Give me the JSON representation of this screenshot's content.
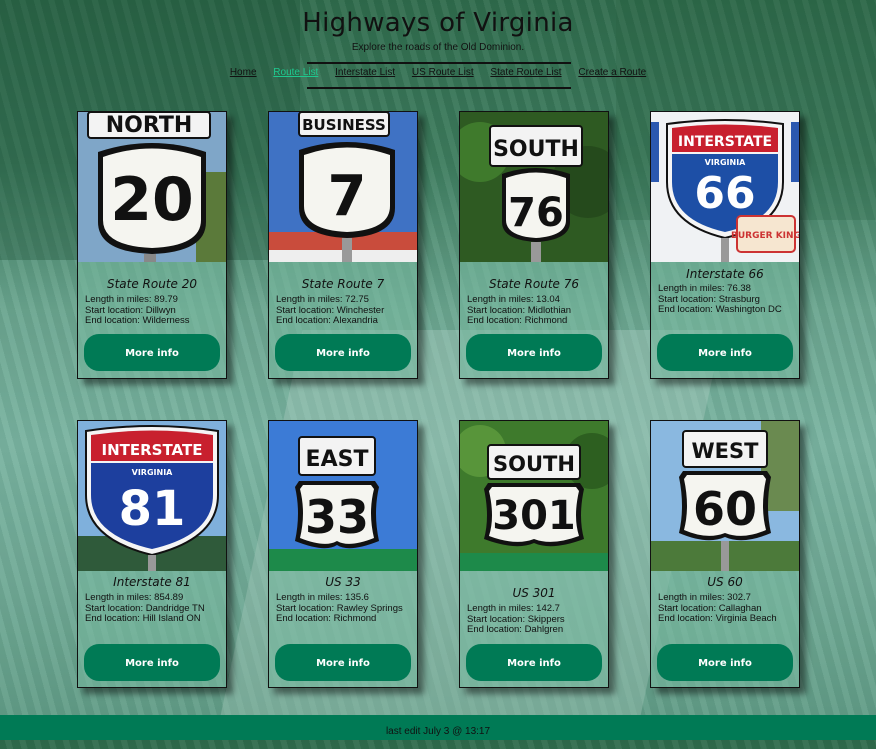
{
  "header": {
    "title": "Highways of Virginia",
    "subtitle": "Explore the roads of the Old Dominion."
  },
  "nav": {
    "items": [
      {
        "label": "Home"
      },
      {
        "label": "Route List",
        "active": true
      },
      {
        "label": "Interstate List"
      },
      {
        "label": "US Route List"
      },
      {
        "label": "State Route List"
      },
      {
        "label": "Create a Route"
      }
    ]
  },
  "cards": [
    {
      "title": "State Route 20",
      "length": "Length in miles: 89.79",
      "start": "Start location: Dillwyn",
      "end": "End location: Wilderness",
      "button": "More info",
      "sign": {
        "kind": "state",
        "number": "20",
        "plate": "NORTH"
      }
    },
    {
      "title": "State Route 7",
      "length": "Length in miles: 72.75",
      "start": "Start location: Winchester",
      "end": "End location: Alexandria",
      "button": "More info",
      "sign": {
        "kind": "state",
        "number": "7",
        "plate": "BUSINESS"
      }
    },
    {
      "title": "State Route 76",
      "length": "Length in miles: 13.04",
      "start": "Start location: Midlothian",
      "end": "End location: Richmond",
      "button": "More info",
      "sign": {
        "kind": "state",
        "number": "76",
        "plate": "SOUTH"
      }
    },
    {
      "title": "Interstate 66",
      "length": "Length in miles: 76.38",
      "start": "Start location: Strasburg",
      "end": "End location: Washington DC",
      "button": "More info",
      "sign": {
        "kind": "interstate",
        "number": "66",
        "state": "VIRGINIA",
        "banner": "INTERSTATE",
        "extra": "BURGER KING"
      }
    },
    {
      "title": "Interstate 81",
      "length": "Length in miles: 854.89",
      "start": "Start location: Dandridge TN",
      "end": "End location: Hill Island ON",
      "button": "More info",
      "sign": {
        "kind": "interstate",
        "number": "81",
        "state": "VIRGINIA",
        "banner": "INTERSTATE"
      }
    },
    {
      "title": "US 33",
      "length": "Length in miles: 135.6",
      "start": "Start location: Rawley Springs",
      "end": "End location: Richmond",
      "button": "More info",
      "sign": {
        "kind": "us",
        "number": "33",
        "plate": "EAST"
      }
    },
    {
      "title": "US 301",
      "length": "Length in miles: 142.7",
      "start": "Start location: Skippers",
      "end": "End location: Dahlgren",
      "button": "More info",
      "sign": {
        "kind": "us",
        "number": "301",
        "plate": "SOUTH"
      }
    },
    {
      "title": "US 60",
      "length": "Length in miles: 302.7",
      "start": "Start location: Callaghan",
      "end": "End location: Virginia Beach",
      "button": "More info",
      "sign": {
        "kind": "us",
        "number": "60",
        "plate": "WEST"
      }
    }
  ],
  "footer": {
    "text": "last edit July 3 @ 13:17"
  },
  "colors": {
    "accent": "#007a55",
    "nav_active": "#1ec98f"
  }
}
